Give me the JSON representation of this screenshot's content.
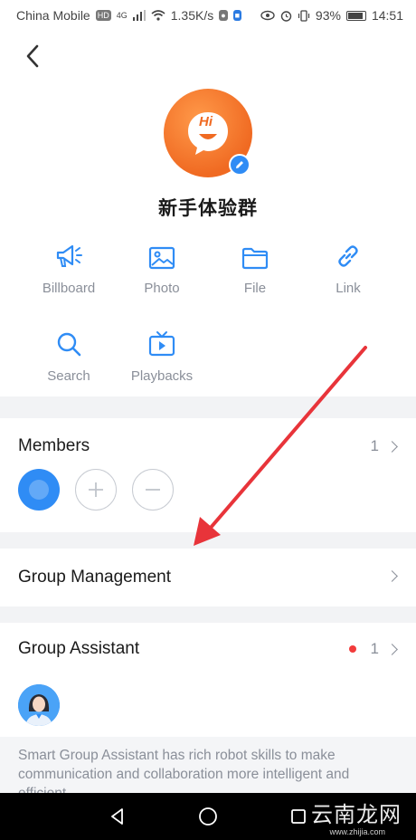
{
  "status_bar": {
    "carrier": "China Mobile",
    "network_badge": "HD",
    "signal_type": "4G",
    "speed": "1.35K/s",
    "battery": "93%",
    "time": "14:51"
  },
  "header": {
    "back_icon": "chevron-left-icon"
  },
  "group": {
    "avatar_text": "Hi",
    "name": "新手体验群"
  },
  "tools": [
    {
      "label": "Billboard",
      "icon": "megaphone-icon"
    },
    {
      "label": "Photo",
      "icon": "image-icon"
    },
    {
      "label": "File",
      "icon": "folder-icon"
    },
    {
      "label": "Link",
      "icon": "link-icon"
    },
    {
      "label": "Search",
      "icon": "search-icon"
    },
    {
      "label": "Playbacks",
      "icon": "tv-icon"
    }
  ],
  "members": {
    "title": "Members",
    "count": "1"
  },
  "group_management": {
    "title": "Group Management"
  },
  "group_assistant": {
    "title": "Group Assistant",
    "count": "1",
    "description": "Smart Group Assistant has rich robot skills to make communication and collaboration more intelligent and efficient"
  },
  "watermark": {
    "text": "云南龙网",
    "url": "www.zhijia.com"
  },
  "colors": {
    "accent": "#2f8cf5",
    "avatar_orange": "#f06a22",
    "badge_red": "#f23b3b",
    "arrow_red": "#e8343a"
  }
}
